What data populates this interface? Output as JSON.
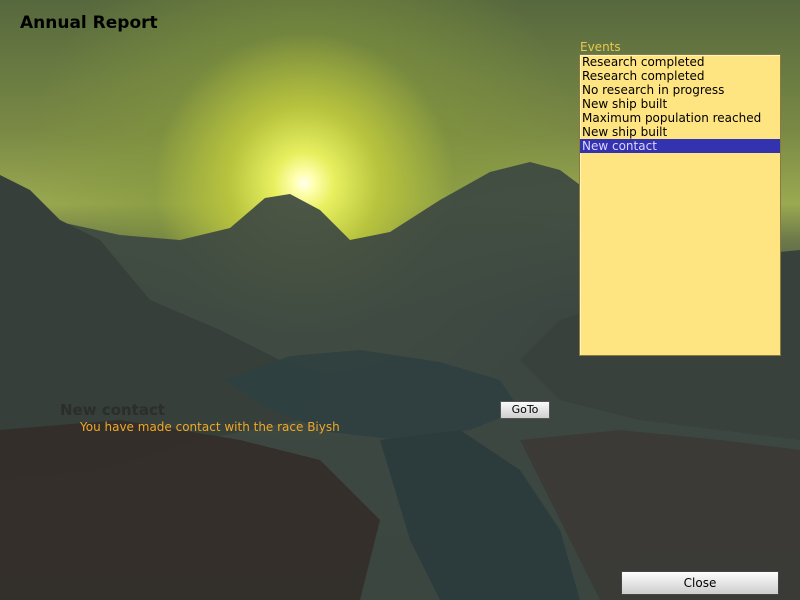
{
  "window": {
    "title": "Annual Report"
  },
  "events": {
    "label": "Events",
    "items": [
      {
        "label": "Research completed",
        "selected": false
      },
      {
        "label": "Research completed",
        "selected": false
      },
      {
        "label": "No research in progress",
        "selected": false
      },
      {
        "label": "New ship built",
        "selected": false
      },
      {
        "label": "Maximum population reached",
        "selected": false
      },
      {
        "label": "New ship built",
        "selected": false
      },
      {
        "label": "New contact",
        "selected": true
      }
    ]
  },
  "detail": {
    "title": "New contact",
    "message": "You have made contact with the race Biysh",
    "goto_label": "GoTo"
  },
  "footer": {
    "close_label": "Close"
  },
  "colors": {
    "list_background": "#ffe482",
    "selection": "#3333b0",
    "message_text": "#f0a828",
    "events_label": "#e8c850"
  }
}
